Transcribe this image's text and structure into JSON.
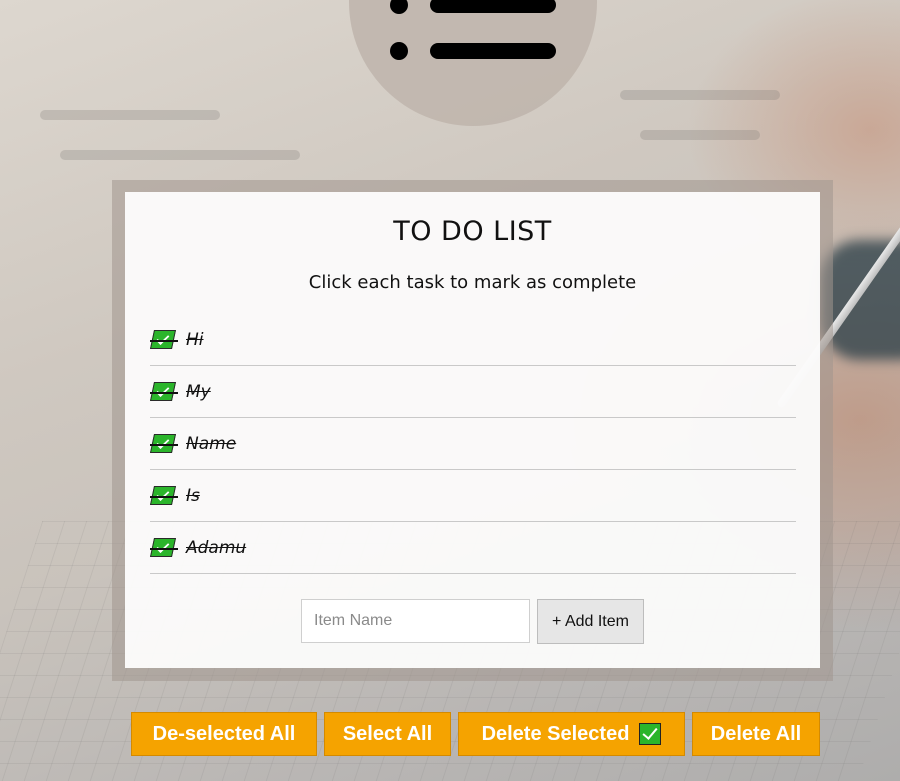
{
  "header": {
    "logo_icon": "list-icon"
  },
  "card": {
    "title": "TO DO LIST",
    "subtitle": "Click each task to mark as complete",
    "items": [
      {
        "label": "Hi",
        "completed": true
      },
      {
        "label": "My",
        "completed": true
      },
      {
        "label": "Name",
        "completed": true
      },
      {
        "label": "Is",
        "completed": true
      },
      {
        "label": "Adamu",
        "completed": true
      }
    ],
    "input": {
      "value": "",
      "placeholder": "Item Name"
    },
    "add_button": "+ Add Item"
  },
  "actions": {
    "deselect_all": "De-selected All",
    "select_all": "Select All",
    "delete_selected": "Delete Selected",
    "delete_all": "Delete All"
  },
  "colors": {
    "accent": "#f5a300",
    "check": "#2bb52b"
  }
}
